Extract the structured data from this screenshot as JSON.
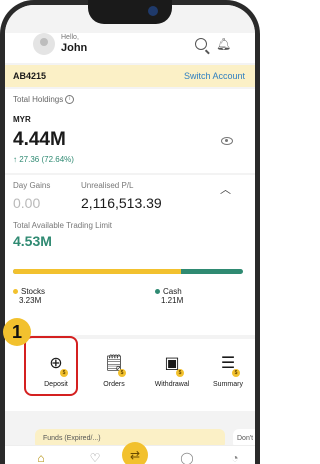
{
  "header": {
    "greeting": "Hello,",
    "user_name": "John"
  },
  "account": {
    "number": "AB4215",
    "switch_label": "Switch Account"
  },
  "holdings": {
    "label": "Total Holdings",
    "currency": "MYR",
    "amount": "4.44M",
    "change": "↑ 27.36 (72.64%)"
  },
  "summary": {
    "day_gains_label": "Day Gains",
    "day_gains_value": "0.00",
    "unrealised_label": "Unrealised P/L",
    "unrealised_value": "2,116,513.39",
    "trading_limit_label": "Total Available Trading Limit",
    "trading_limit_value": "4.53M",
    "allocation": {
      "stocks_fraction": 0.73
    },
    "stocks_label": "Stocks",
    "stocks_value": "3.23M",
    "cash_label": "Cash",
    "cash_value": "1.21M"
  },
  "actions": [
    {
      "label": "Deposit",
      "icon": "deposit-icon"
    },
    {
      "label": "Orders",
      "icon": "orders-icon"
    },
    {
      "label": "Withdrawal",
      "icon": "withdrawal-icon"
    },
    {
      "label": "Summary",
      "icon": "summary-icon"
    }
  ],
  "step_badge": "1",
  "peek_cards": {
    "first": "Funds (Expired/...)",
    "second": "Don't"
  },
  "colors": {
    "accent_yellow": "#f2c12e",
    "accent_green": "#2f8a72",
    "link_blue": "#2f7fc1",
    "highlight_red": "#d42020"
  },
  "nav": {
    "items": [
      "home-icon",
      "watchlist-icon",
      "trade-icon",
      "ideas-icon",
      "portfolio-icon"
    ]
  }
}
